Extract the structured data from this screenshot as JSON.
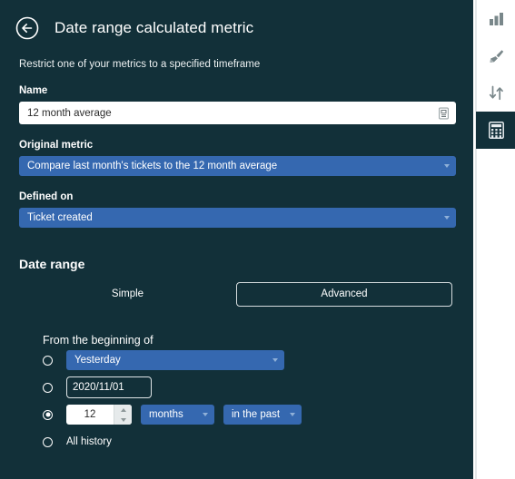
{
  "header": {
    "back_icon": "back-arrow-circle-icon",
    "title": "Date range calculated metric",
    "subtitle": "Restrict one of your metrics to a specified timeframe"
  },
  "form": {
    "name": {
      "label": "Name",
      "value": "12 month average",
      "placeholder": "",
      "trailing_icon": "translation-icon"
    },
    "original_metric": {
      "label": "Original metric",
      "value": "Compare last month's tickets to the 12 month average"
    },
    "defined_on": {
      "label": "Defined on",
      "value": "Ticket created"
    }
  },
  "date_range": {
    "heading": "Date range",
    "modes": {
      "simple": "Simple",
      "advanced": "Advanced",
      "selected": "Advanced"
    },
    "from_label": "From the beginning of",
    "options": [
      {
        "id": "preset",
        "selected": false,
        "value": "Yesterday"
      },
      {
        "id": "specific-date",
        "selected": false,
        "value": "2020/11/01"
      },
      {
        "id": "relative",
        "selected": true,
        "amount": "12",
        "unit": "months",
        "direction": "in the past"
      },
      {
        "id": "all-history",
        "selected": false,
        "label": "All history"
      }
    ]
  },
  "sidebar": {
    "items": [
      {
        "icon": "bar-chart-icon",
        "active": false
      },
      {
        "icon": "paint-brush-icon",
        "active": false
      },
      {
        "icon": "sort-arrows-icon",
        "active": false
      },
      {
        "icon": "calculator-icon",
        "active": true
      }
    ]
  },
  "colors": {
    "panel_background": "#123039",
    "accent_blue": "#3568b0",
    "input_white": "#ffffff",
    "rail_background": "#ffffff",
    "rail_active": "#123039"
  }
}
